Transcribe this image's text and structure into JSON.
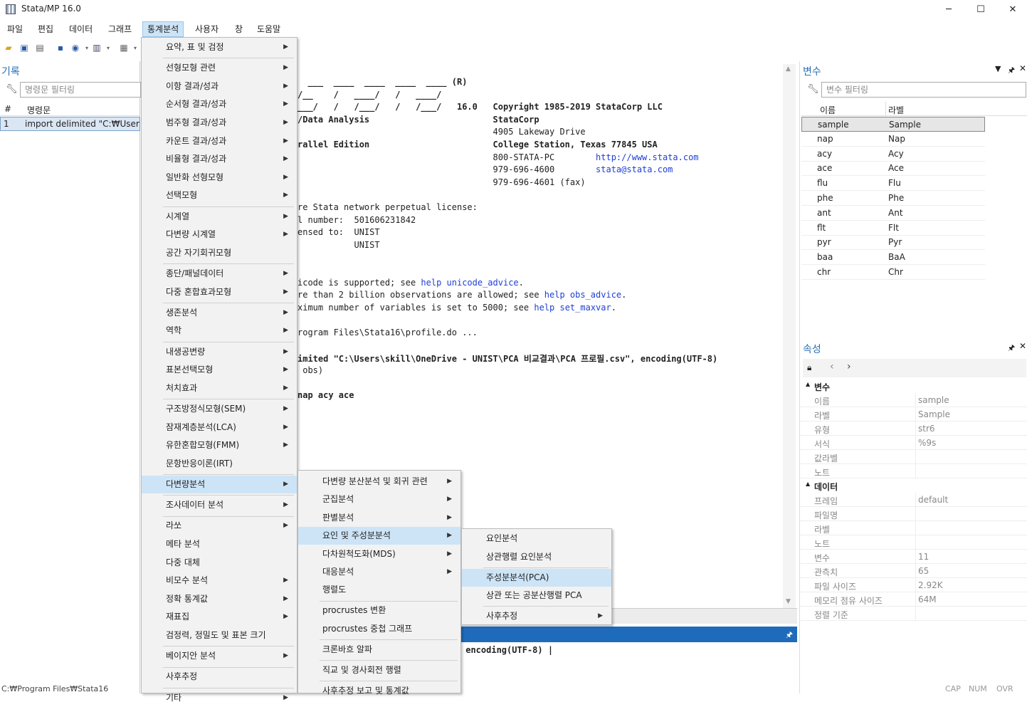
{
  "window": {
    "title": "Stata/MP 16.0",
    "minimize": "─",
    "maximize": "☐",
    "close": "✕"
  },
  "menubar": [
    "파일",
    "편집",
    "데이터",
    "그래프",
    "통계분석",
    "사용자",
    "창",
    "도움말"
  ],
  "history": {
    "title": "기록",
    "filter_placeholder": "명령문 필터링",
    "col_num": "#",
    "col_cmd": "명령문",
    "rows": [
      {
        "num": "1",
        "cmd": "import delimited \"C:₩Users₩s"
      }
    ]
  },
  "results": {
    "lines": [
      {
        "t": "  ___  ____  ____  ____  ____ (R)",
        "b": true
      },
      {
        "t": "/__    /   ____/   /   ____/",
        "b": true
      },
      {
        "t": "___/   /   /___/   /   /___/   16.0   Copyright 1985-2019 StataCorp LLC",
        "b": true
      },
      {
        "t": "/Data Analysis                        StataCorp",
        "b": true
      },
      {
        "t": "                                      4905 Lakeway Drive"
      },
      {
        "t": "rallel Edition                        College Station, Texas 77845 USA",
        "b": true
      },
      {
        "t": "                                      800-STATA-PC        http://www.stata.com"
      },
      {
        "t": "                                      979-696-4600        stata@stata.com"
      },
      {
        "t": "                                      979-696-4601 (fax)"
      },
      {
        "t": ""
      },
      {
        "t": "re Stata network perpetual license:"
      },
      {
        "t": "l number:  501606231842"
      },
      {
        "t": "ensed to:  UNIST"
      },
      {
        "t": "           UNIST"
      },
      {
        "t": ""
      },
      {
        "t": ""
      },
      {
        "t": "icode is supported; see help unicode_advice."
      },
      {
        "t": "re than 2 billion observations are allowed; see help obs_advice."
      },
      {
        "t": "ximum number of variables is set to 5000; see help set_maxvar."
      },
      {
        "t": ""
      },
      {
        "t": "rogram Files\\Stata16\\profile.do ..."
      },
      {
        "t": ""
      },
      {
        "t": "imited \"C:\\Users\\skill\\OneDrive - UNIST\\PCA 비교결과\\PCA 프로필.csv\", encoding(UTF-8)",
        "b": true
      },
      {
        "t": " obs)"
      },
      {
        "t": ""
      },
      {
        "t": "nap acy ace",
        "b": true
      }
    ]
  },
  "command": {
    "text": "UNIST\\PCA 비교결과\\PCA 프로필.csv\", encoding(UTF-8) |"
  },
  "variables": {
    "title": "변수",
    "filter_placeholder": "변수 필터링",
    "col_name": "이름",
    "col_label": "라벨",
    "rows": [
      [
        "sample",
        "Sample"
      ],
      [
        "nap",
        "Nap"
      ],
      [
        "acy",
        "Acy"
      ],
      [
        "ace",
        "Ace"
      ],
      [
        "flu",
        "Flu"
      ],
      [
        "phe",
        "Phe"
      ],
      [
        "ant",
        "Ant"
      ],
      [
        "flt",
        "Flt"
      ],
      [
        "pyr",
        "Pyr"
      ],
      [
        "baa",
        "BaA"
      ],
      [
        "chr",
        "Chr"
      ]
    ]
  },
  "properties": {
    "title": "속성",
    "group_var": "변수",
    "var_rows": [
      [
        "이름",
        "sample"
      ],
      [
        "라벨",
        "Sample"
      ],
      [
        "유형",
        "str6"
      ],
      [
        "서식",
        "%9s"
      ],
      [
        "값라벨",
        ""
      ],
      [
        "노트",
        ""
      ]
    ],
    "group_data": "데이터",
    "data_rows": [
      [
        "프레임",
        "default"
      ],
      [
        "파일명",
        ""
      ],
      [
        "라벨",
        ""
      ],
      [
        "노트",
        ""
      ],
      [
        "변수",
        "11"
      ],
      [
        "관측치",
        "65"
      ],
      [
        "파일 사이즈",
        "2.92K"
      ],
      [
        "메모리 점유 사이즈",
        "64M"
      ],
      [
        "정렬 기준",
        ""
      ]
    ]
  },
  "menu_stats": [
    {
      "l": "요약, 표 및 검정",
      "a": true
    },
    {
      "sep": true
    },
    {
      "l": "선형모형 관련",
      "a": true
    },
    {
      "l": "이항 결과/성과",
      "a": true
    },
    {
      "l": "순서형 결과/성과",
      "a": true
    },
    {
      "l": "범주형 결과/성과",
      "a": true
    },
    {
      "l": "카운트 결과/성과",
      "a": true
    },
    {
      "l": "비율형 결과/성과",
      "a": true
    },
    {
      "l": "일반화 선형모형",
      "a": true
    },
    {
      "l": "선택모형",
      "a": true
    },
    {
      "sep": true
    },
    {
      "l": "시계열",
      "a": true
    },
    {
      "l": "다변량 시계열",
      "a": true
    },
    {
      "l": "공간 자기회귀모형",
      "a": false
    },
    {
      "sep": true
    },
    {
      "l": "종단/패널데이터",
      "a": true
    },
    {
      "l": "다중 혼합효과모형",
      "a": true
    },
    {
      "sep": true
    },
    {
      "l": "생존분석",
      "a": true
    },
    {
      "l": "역학",
      "a": true
    },
    {
      "sep": true
    },
    {
      "l": "내생공변량",
      "a": true
    },
    {
      "l": "표본선택모형",
      "a": true
    },
    {
      "l": "처치효과",
      "a": true
    },
    {
      "sep": true
    },
    {
      "l": "구조방정식모형(SEM)",
      "a": true
    },
    {
      "l": "잠재계층분석(LCA)",
      "a": true
    },
    {
      "l": "유한혼합모형(FMM)",
      "a": true
    },
    {
      "l": "문항반응이론(IRT)",
      "a": false
    },
    {
      "sep": true
    },
    {
      "l": "다변량분석",
      "a": true,
      "h": true
    },
    {
      "sep": true
    },
    {
      "l": "조사데이터 분석",
      "a": true
    },
    {
      "sep": true
    },
    {
      "l": "라쏘",
      "a": true
    },
    {
      "l": "메타 분석",
      "a": false
    },
    {
      "l": "다중 대체",
      "a": false
    },
    {
      "l": "비모수 분석",
      "a": true
    },
    {
      "l": "정확 통계값",
      "a": true
    },
    {
      "l": "재표집",
      "a": true
    },
    {
      "l": "검정력, 정밀도 및 표본 크기",
      "a": false
    },
    {
      "sep": true
    },
    {
      "l": "베이지안 분석",
      "a": true
    },
    {
      "sep": true
    },
    {
      "l": "사후추정",
      "a": false
    },
    {
      "sep": true
    },
    {
      "l": "기타",
      "a": true
    }
  ],
  "menu_multi": [
    {
      "l": "다변량 분산분석 및 회귀 관련",
      "a": true
    },
    {
      "l": "군집분석",
      "a": true
    },
    {
      "l": "판별분석",
      "a": true
    },
    {
      "l": "요인 및 주성분분석",
      "a": true,
      "h": true
    },
    {
      "l": "다차원척도화(MDS)",
      "a": true
    },
    {
      "l": "대응분석",
      "a": true
    },
    {
      "l": "행렬도",
      "a": false
    },
    {
      "sep": true
    },
    {
      "l": "procrustes 변환",
      "a": false
    },
    {
      "l": "procrustes 중첩 그래프",
      "a": false
    },
    {
      "sep": true
    },
    {
      "l": "크론바흐 알파",
      "a": false
    },
    {
      "sep": true
    },
    {
      "l": "직교 및 경사회전 행렬",
      "a": false
    },
    {
      "sep": true
    },
    {
      "l": "사후추정 보고 및 통계값",
      "a": false
    }
  ],
  "menu_factor": [
    {
      "l": "요인분석",
      "a": false
    },
    {
      "l": "상관행렬 요인분석",
      "a": false
    },
    {
      "sep": true
    },
    {
      "l": "주성분분석(PCA)",
      "a": false,
      "h": true
    },
    {
      "l": "상관 또는 공분산행렬 PCA",
      "a": false
    },
    {
      "sep": true
    },
    {
      "l": "사후추정",
      "a": true
    }
  ],
  "status": {
    "path": "C:₩Program Files₩Stata16",
    "cap": "CAP",
    "num": "NUM",
    "ovr": "OVR"
  }
}
